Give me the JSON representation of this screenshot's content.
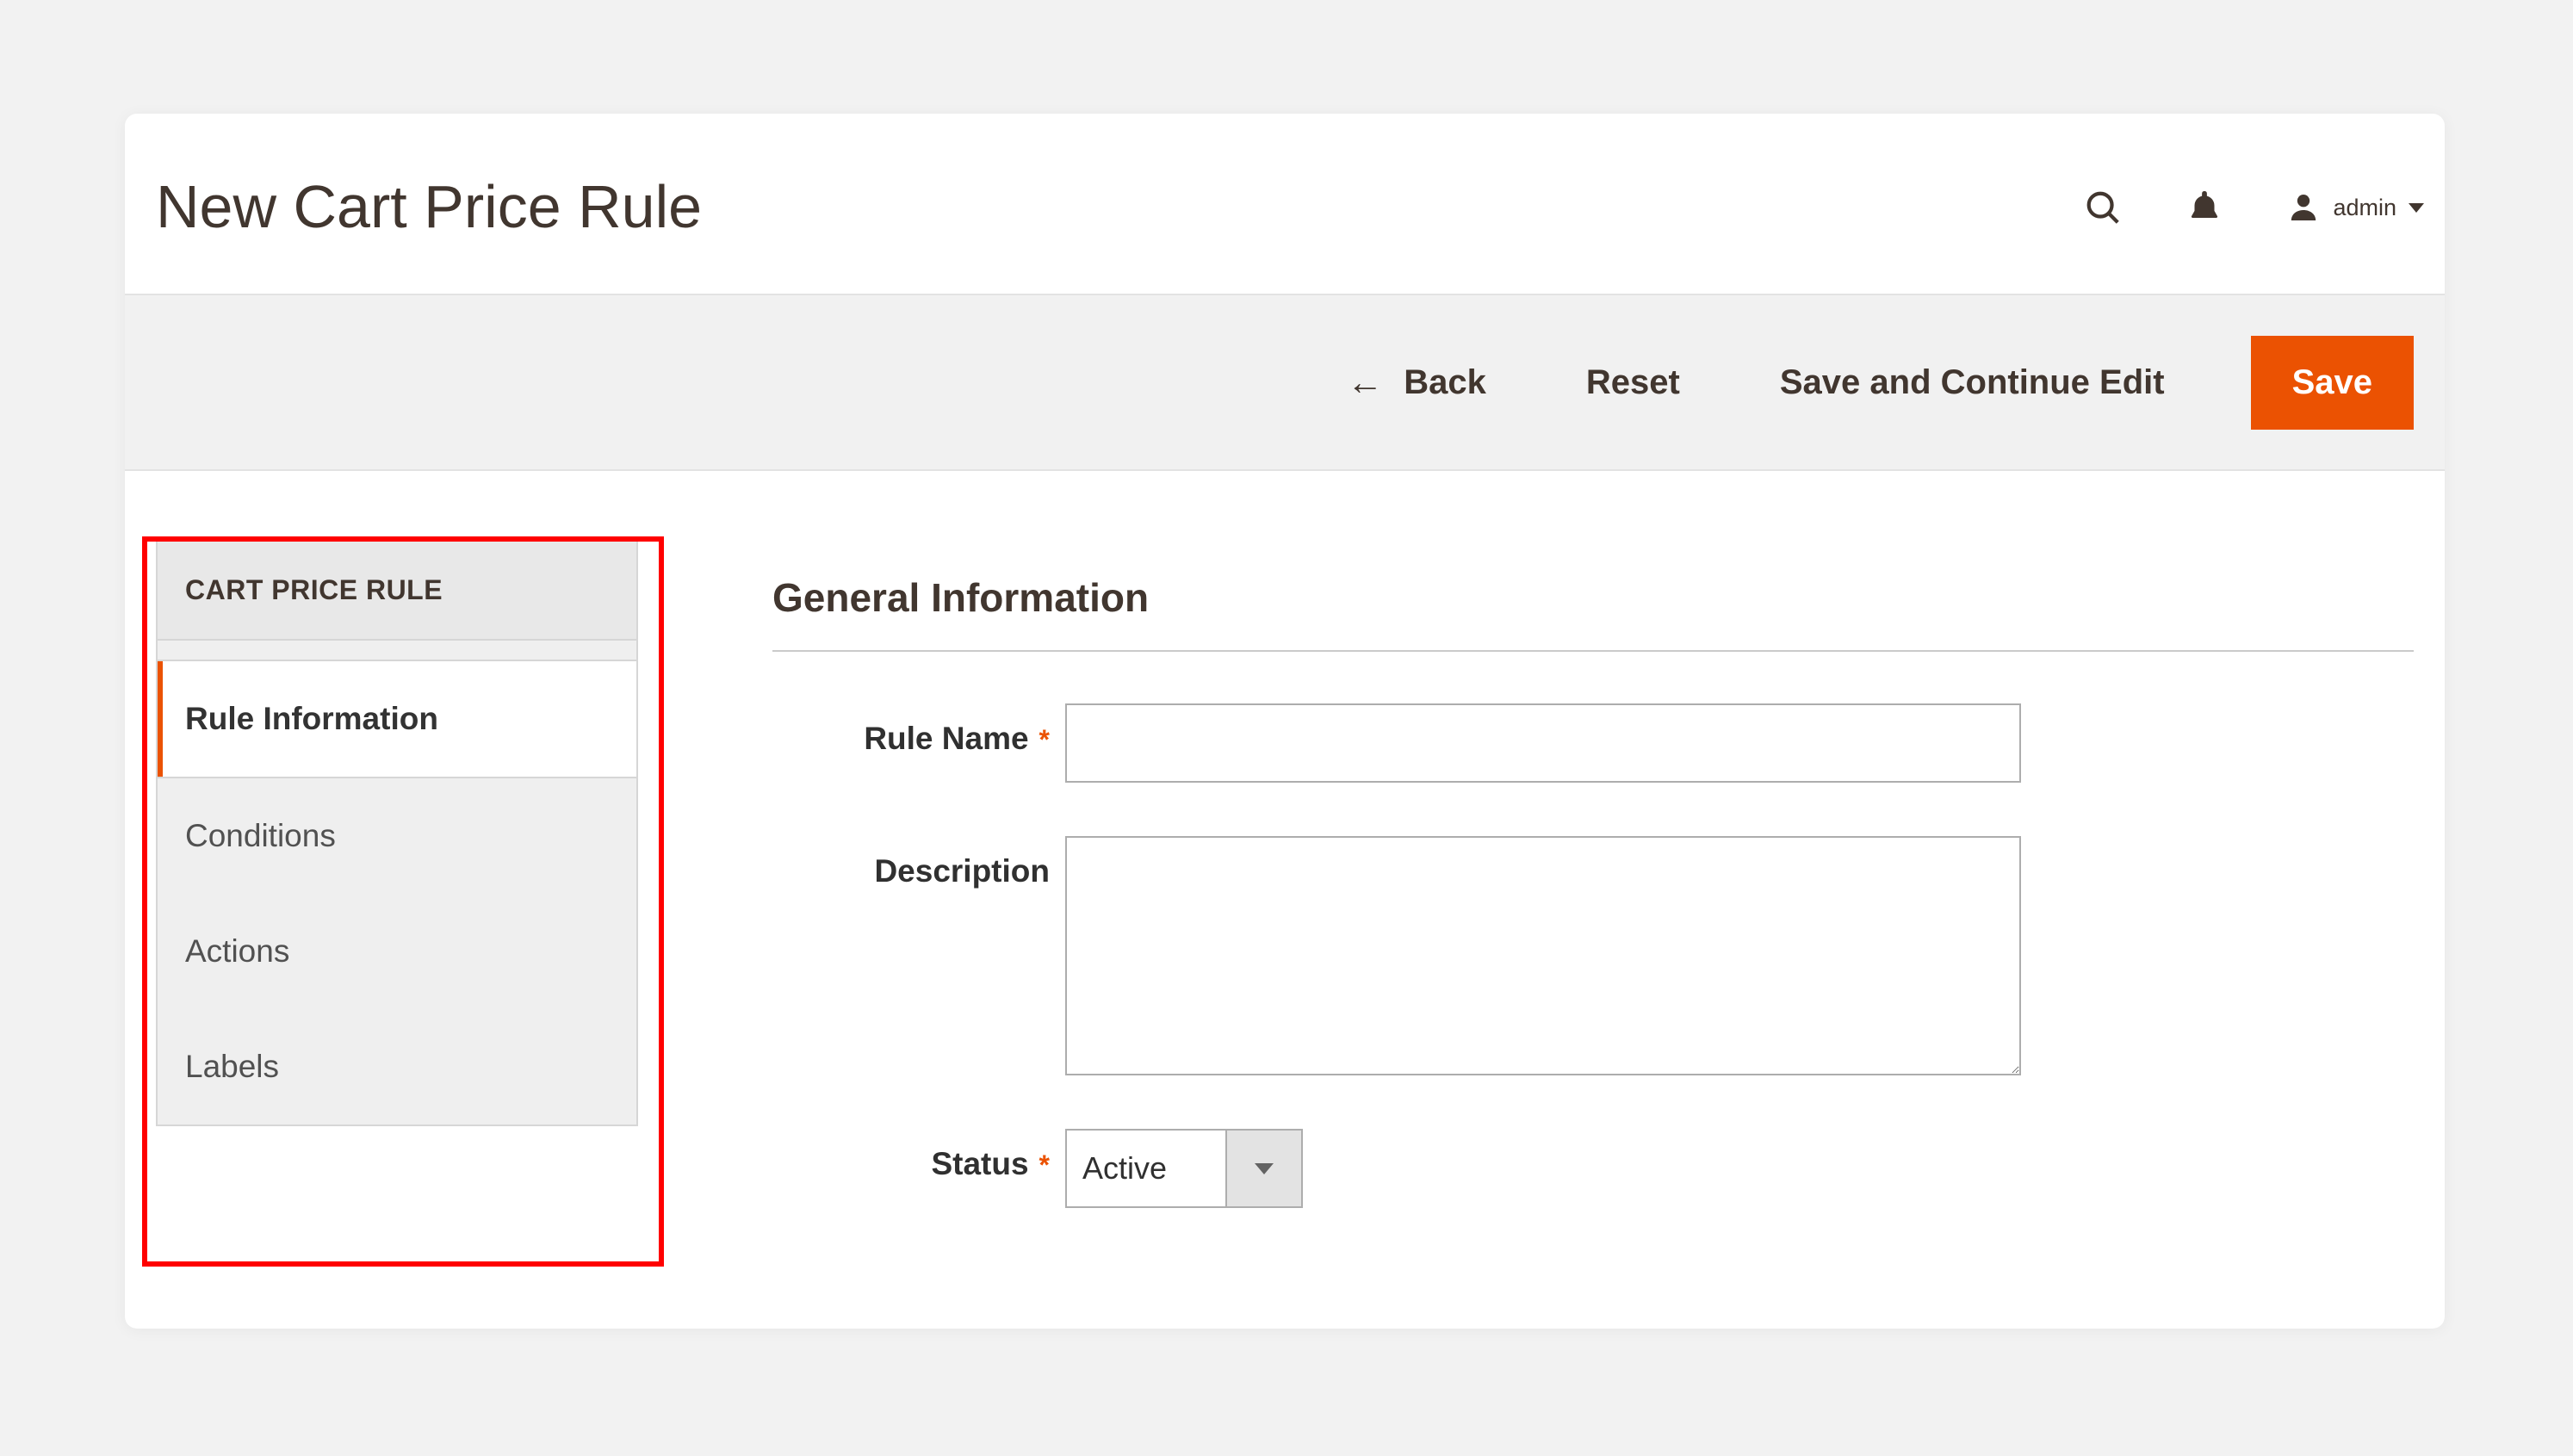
{
  "header": {
    "page_title": "New Cart Price Rule",
    "user_label": "admin"
  },
  "actions": {
    "back": "Back",
    "reset": "Reset",
    "save_continue": "Save and Continue Edit",
    "save": "Save"
  },
  "sidebar": {
    "title": "CART PRICE RULE",
    "items": [
      {
        "label": "Rule Information",
        "active": true
      },
      {
        "label": "Conditions",
        "active": false
      },
      {
        "label": "Actions",
        "active": false
      },
      {
        "label": "Labels",
        "active": false
      }
    ]
  },
  "form": {
    "section_title": "General Information",
    "rule_name": {
      "label": "Rule Name",
      "required": true,
      "value": ""
    },
    "description": {
      "label": "Description",
      "required": false,
      "value": ""
    },
    "status": {
      "label": "Status",
      "required": true,
      "value": "Active"
    }
  },
  "required_star": "*"
}
